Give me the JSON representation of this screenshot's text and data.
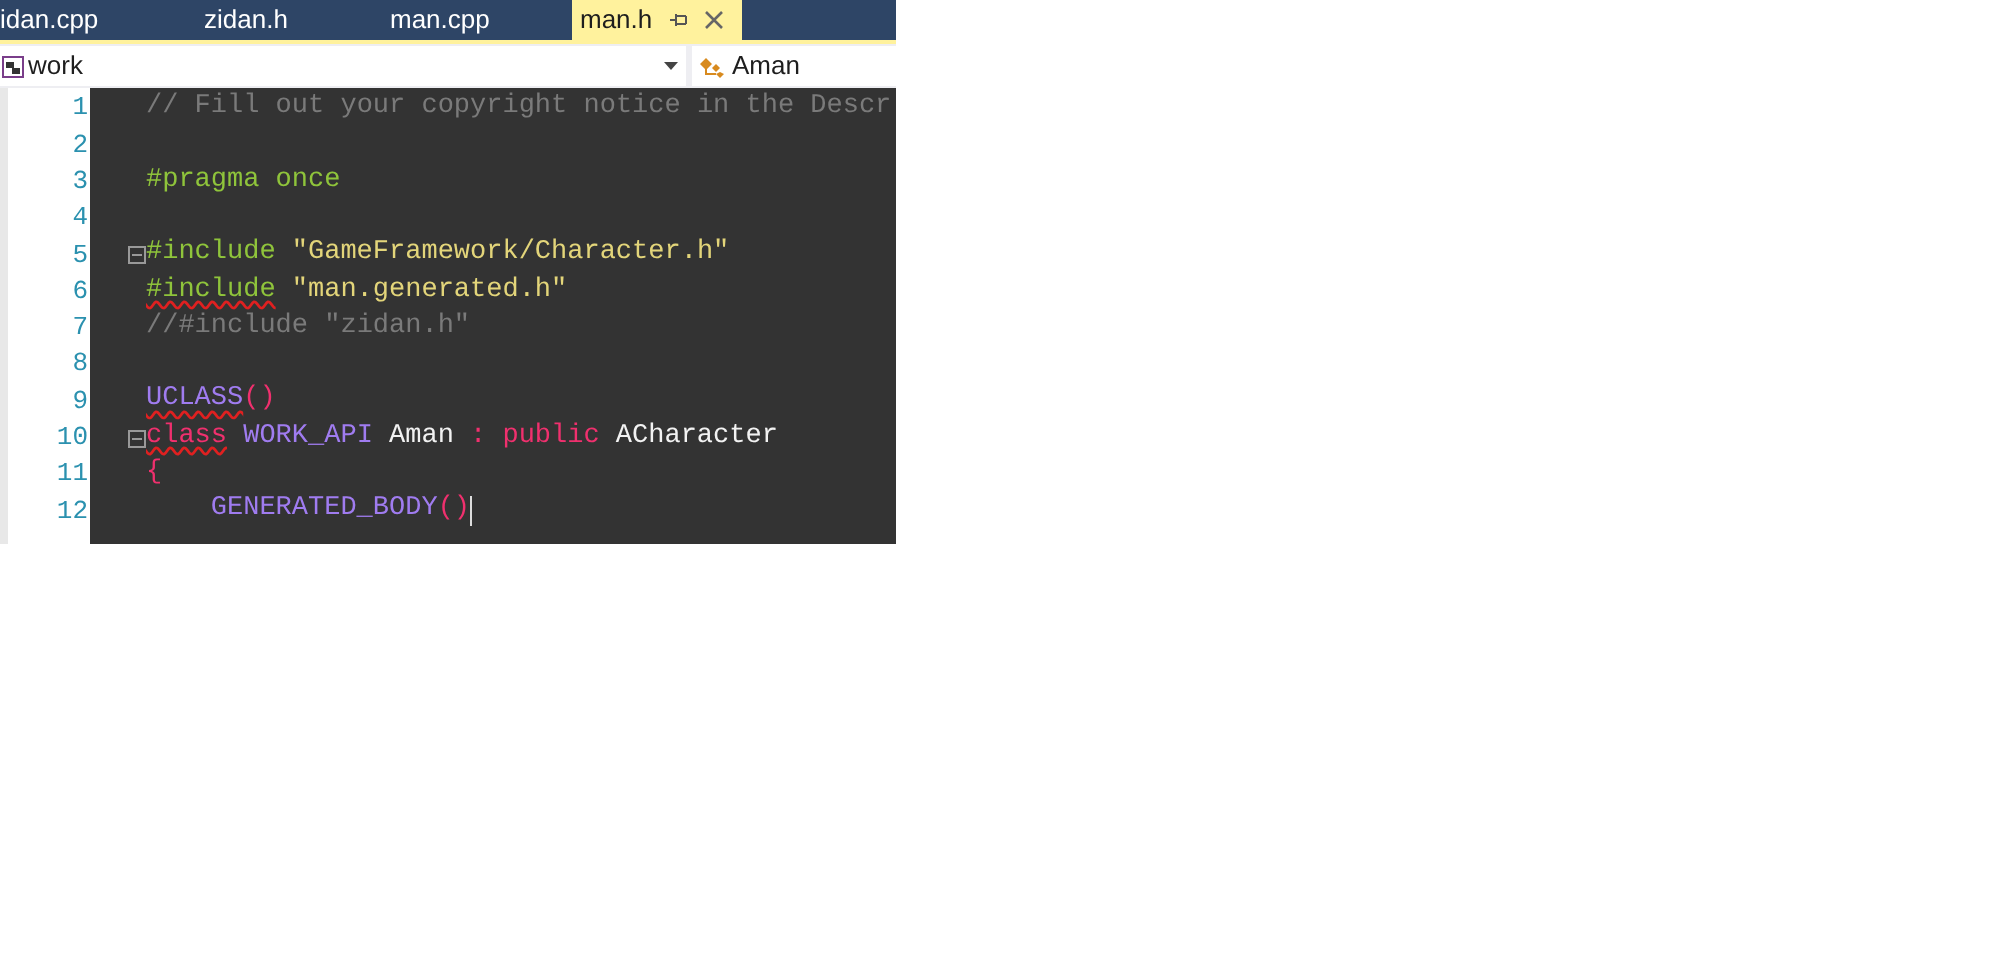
{
  "tabs": [
    {
      "label": "idan.cpp",
      "selected": false
    },
    {
      "label": "zidan.h",
      "selected": false
    },
    {
      "label": "man.cpp",
      "selected": false
    },
    {
      "label": "man.h",
      "selected": true
    }
  ],
  "nav": {
    "project": "work",
    "member": "Aman"
  },
  "code_lines": [
    {
      "number": "1",
      "fold": false,
      "cursor": false,
      "tokens": [
        {
          "kind": "comment",
          "text": "// Fill out your copyright notice in the Descr",
          "squiggle": false
        }
      ]
    },
    {
      "number": "2",
      "fold": false,
      "cursor": false
    },
    {
      "number": "3",
      "fold": false,
      "cursor": false,
      "tokens": [
        {
          "kind": "preproc",
          "text": "#pragma once",
          "squiggle": false
        }
      ]
    },
    {
      "number": "4",
      "fold": false,
      "cursor": false
    },
    {
      "number": "5",
      "fold": true,
      "cursor": false,
      "tokens": [
        {
          "kind": "preproc",
          "text": "#include",
          "squiggle": false
        },
        {
          "kind": "string",
          "text": "\"GameFramework/Character.h\"",
          "squiggle": false
        }
      ]
    },
    {
      "number": "6",
      "fold": false,
      "cursor": false,
      "tokens": [
        {
          "kind": "preproc",
          "text": "#include",
          "squiggle": true
        },
        {
          "kind": "string",
          "text": "\"man.generated.h\"",
          "squiggle": false
        }
      ]
    },
    {
      "number": "7",
      "fold": false,
      "cursor": false,
      "tokens": [
        {
          "kind": "comment",
          "text": "//#include \"zidan.h\"",
          "squiggle": false
        }
      ]
    },
    {
      "number": "8",
      "fold": false,
      "cursor": false
    },
    {
      "number": "9",
      "fold": false,
      "cursor": false,
      "tokens": [
        {
          "kind": "macro",
          "text": "UCLASS",
          "squiggle": true
        },
        {
          "kind": "parens",
          "text": "()",
          "squiggle": false
        }
      ]
    },
    {
      "number": "10",
      "fold": true,
      "cursor": false,
      "tokens": [
        {
          "kind": "keyword",
          "text": "class",
          "squiggle": true
        },
        {
          "kind": "macro",
          "text": "WORK_API",
          "squiggle": false
        },
        {
          "kind": "plain",
          "text": "Aman",
          "squiggle": false
        },
        {
          "kind": "punct",
          "text": ":",
          "squiggle": false
        },
        {
          "kind": "keyword",
          "text": "public",
          "squiggle": false
        },
        {
          "kind": "plain",
          "text": "ACharacter",
          "squiggle": false
        }
      ]
    },
    {
      "number": "11",
      "fold": false,
      "cursor": false,
      "tokens": [
        {
          "kind": "punct",
          "text": "{",
          "squiggle": false
        }
      ]
    },
    {
      "number": "12",
      "fold": false,
      "cursor": true,
      "indent": true,
      "tokens": [
        {
          "kind": "macro",
          "text": "GENERATED_BODY",
          "squiggle": false
        },
        {
          "kind": "parens",
          "text": "()",
          "squiggle": false
        }
      ]
    }
  ]
}
